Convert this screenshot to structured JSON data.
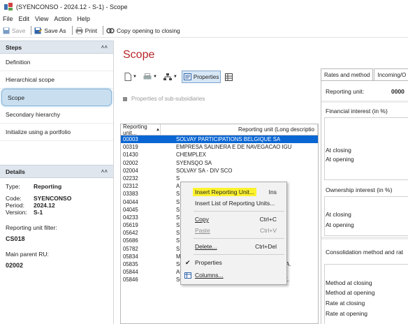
{
  "window": {
    "title": "(SYENCONSO - 2024.12 - S-1) - Scope"
  },
  "menu": [
    "File",
    "Edit",
    "View",
    "Action",
    "Help"
  ],
  "toolbar": {
    "save": "Save",
    "save_as": "Save As",
    "print": "Print",
    "copy_opening": "Copy opening to closing"
  },
  "steps_panel": {
    "title": "Steps",
    "items": [
      "Definition",
      "Hierarchical scope",
      "Scope",
      "Secondary hierarchy",
      "Initialize using a portfolio"
    ],
    "active": "Scope"
  },
  "details_panel": {
    "title": "Details",
    "rows": [
      {
        "k": "Type:",
        "v": "Reporting"
      },
      {
        "k": "Code:",
        "v": "SYENCONSO"
      },
      {
        "k": "Period:",
        "v": "2024.12"
      },
      {
        "k": "Version:",
        "v": "S-1"
      }
    ],
    "filter_label": "Reporting unit filter:",
    "filter_value": "CS018",
    "parent_label": "Main parent RU:",
    "parent_value": "02002"
  },
  "main": {
    "title": "Scope",
    "properties_button": "Properties",
    "subsidiaries_label": "Properties of sub-subsidiaries",
    "grid": {
      "col1": "Reporting unit...",
      "col2": "Reporting unit (Long descriptio",
      "rows": [
        [
          "00003",
          "SOLVAY PARTICIPATIONS BELGIQUE SA"
        ],
        [
          "00319",
          "EMPRESA SALINERA E DE NAVEGACAO IGU"
        ],
        [
          "01430",
          "CHEMPLEX"
        ],
        [
          "02002",
          "SYENSQO SA"
        ],
        [
          "02004",
          "SOLVAY SA - DIV SCO"
        ],
        [
          "02232",
          "S"
        ],
        [
          "02312",
          "A"
        ],
        [
          "03383",
          "S"
        ],
        [
          "04044",
          "S"
        ],
        [
          "04045",
          "S"
        ],
        [
          "04233",
          "S"
        ],
        [
          "05619",
          "S"
        ],
        [
          "05642",
          "S"
        ],
        [
          "05686",
          "S"
        ],
        [
          "05782",
          "S"
        ],
        [
          "05834",
          "MOUGUERRE BRISCOUS IMMOBILIER SCI"
        ],
        [
          "05835",
          "SOLVAY SPECIALTY POLYMERS ITALY S.p.A."
        ],
        [
          "05844",
          "AUSIMONT INDUSTRIES INC."
        ],
        [
          "05846",
          "SOLVAY SPECIALTY POLYMERS JAPAN K.K."
        ]
      ],
      "selected_index": 0
    }
  },
  "context_menu": {
    "insert_unit": "Insert Reporting Unit...",
    "insert_unit_sc": "Ins",
    "insert_list": "Insert List of Reporting Units...",
    "copy": "Copy",
    "copy_sc": "Ctrl+C",
    "paste": "Paste",
    "paste_sc": "Ctrl+V",
    "delete": "Delete...",
    "delete_sc": "Ctrl+Del",
    "properties": "Properties",
    "columns": "Columns..."
  },
  "right_panel": {
    "tabs": [
      "Rates and method",
      "Incoming/O"
    ],
    "reporting_unit_label": "Reporting unit:",
    "reporting_unit_value": "0000",
    "financial_interest": "Financial interest (in %)",
    "at_closing": "At closing",
    "at_opening": "At opening",
    "ownership_interest": "Ownership interest (in %)",
    "consolidation": "Consolidation method and rat",
    "method_closing": "Method at closing",
    "method_opening": "Method at opening",
    "rate_closing": "Rate at closing",
    "rate_opening": "Rate at opening"
  },
  "colors": {
    "accent_title": "#b5252a",
    "selection": "#0a66d3",
    "highlight": "#fcf22e"
  }
}
